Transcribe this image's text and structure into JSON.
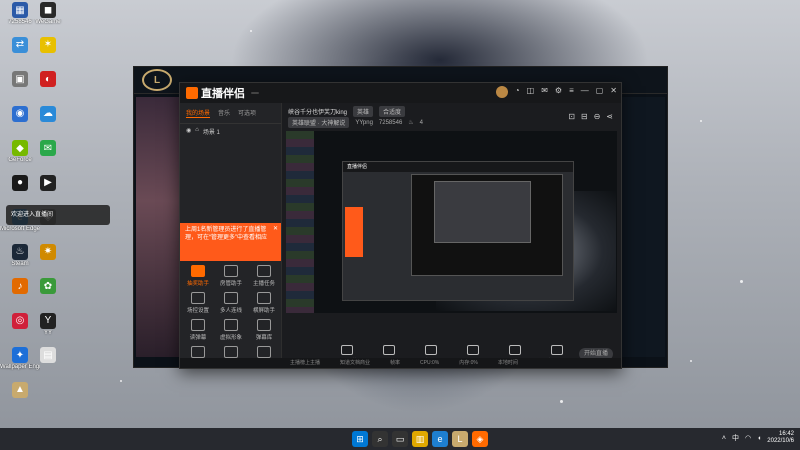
{
  "desktop": {
    "icons_col1": [
      {
        "label": "7258546",
        "glyph": "▦",
        "color": "#2b5aa8"
      },
      {
        "label": "",
        "glyph": "⇄",
        "color": "#3a8fd8"
      },
      {
        "label": "",
        "glyph": "▣",
        "color": "#777"
      },
      {
        "label": "",
        "glyph": "◉",
        "color": "#2d6fd0"
      },
      {
        "label": "GeForce",
        "glyph": "◆",
        "color": "#76b900"
      },
      {
        "label": "",
        "glyph": "●",
        "color": "#1a1a1a"
      },
      {
        "label": "Microsoft Edge",
        "glyph": "e",
        "color": "#1e7fd0"
      },
      {
        "label": "Steam",
        "glyph": "♨",
        "color": "#1b2838"
      },
      {
        "label": "",
        "glyph": "♪",
        "color": "#e26a00"
      },
      {
        "label": "",
        "glyph": "◎",
        "color": "#d0203a"
      },
      {
        "label": "Wallpaper Engine",
        "glyph": "✦",
        "color": "#1d6fd8"
      },
      {
        "label": "",
        "glyph": "▲",
        "color": "#c8aa6e"
      }
    ],
    "icons_col2": [
      {
        "label": "WeGame",
        "glyph": "◼",
        "color": "#2a2a2a"
      },
      {
        "label": "",
        "glyph": "✶",
        "color": "#e8c000"
      },
      {
        "label": "",
        "glyph": "◐",
        "color": "#d02020"
      },
      {
        "label": "",
        "glyph": "☁",
        "color": "#2a8ad8"
      },
      {
        "label": "",
        "glyph": "✉",
        "color": "#2aa84a"
      },
      {
        "label": "",
        "glyph": "▶",
        "color": "#222"
      },
      {
        "label": "",
        "glyph": "◈",
        "color": "#666"
      },
      {
        "label": "",
        "glyph": "✷",
        "color": "#d08a00"
      },
      {
        "label": "",
        "glyph": "✿",
        "color": "#3a9a3a"
      },
      {
        "label": "YY",
        "glyph": "Y",
        "color": "#222"
      },
      {
        "label": "",
        "glyph": "▤",
        "color": "#ddd"
      }
    ],
    "toast": {
      "prefix": "欢迎",
      "highlight": "",
      "suffix": "进入直播间"
    }
  },
  "lol_client": {
    "logo": "L"
  },
  "app": {
    "logo_text": "直播伴侣",
    "version_badge": "",
    "tabs": [
      "我的场景",
      "音乐",
      "可选项"
    ],
    "scene": "场景 1",
    "room": {
      "title": "峡谷千分也伊芙刀king",
      "chip1": "英雄",
      "chip2": "合适度",
      "category": "英雄联盟 · 大神解说",
      "id_label": "YYpng",
      "id": "7258546",
      "fans": "4"
    },
    "promo_text": "上周1名新管理员进行了直播管理，可在“管理更多”中查看相应",
    "tools": [
      {
        "label": "抽奖助手",
        "active": true
      },
      {
        "label": "房管助手",
        "active": false
      },
      {
        "label": "主播任务",
        "active": false
      },
      {
        "label": "场控设置",
        "active": false
      },
      {
        "label": "多人连线",
        "active": false
      },
      {
        "label": "横屏助手",
        "active": false
      },
      {
        "label": "读弹幕",
        "active": false
      },
      {
        "label": "虚拟形象",
        "active": false
      },
      {
        "label": "弹幕库",
        "active": false
      },
      {
        "label": "",
        "active": false
      },
      {
        "label": "",
        "active": false
      },
      {
        "label": "",
        "active": false
      }
    ],
    "bottom_buttons": [
      "直播屏幕",
      "摄像头",
      "手机投屏",
      "多媒体",
      "麦克风",
      "扬声器"
    ],
    "start_label": "开始直播",
    "status": [
      "主播榜上主播",
      "知道文档商业",
      "帧率",
      "CPU:0%",
      "内存:0%",
      "本地时间"
    ]
  },
  "taskbar": {
    "apps": [
      {
        "glyph": "⊞",
        "color": "#0078d4"
      },
      {
        "glyph": "⌕",
        "color": "#333"
      },
      {
        "glyph": "▭",
        "color": "#333"
      },
      {
        "glyph": "▥",
        "color": "#e0a800"
      },
      {
        "glyph": "e",
        "color": "#1e7fd0"
      },
      {
        "glyph": "L",
        "color": "#c8aa6e"
      },
      {
        "glyph": "◈",
        "color": "#ff6a00"
      }
    ],
    "time": "16:42",
    "date": "2022/10/6"
  }
}
